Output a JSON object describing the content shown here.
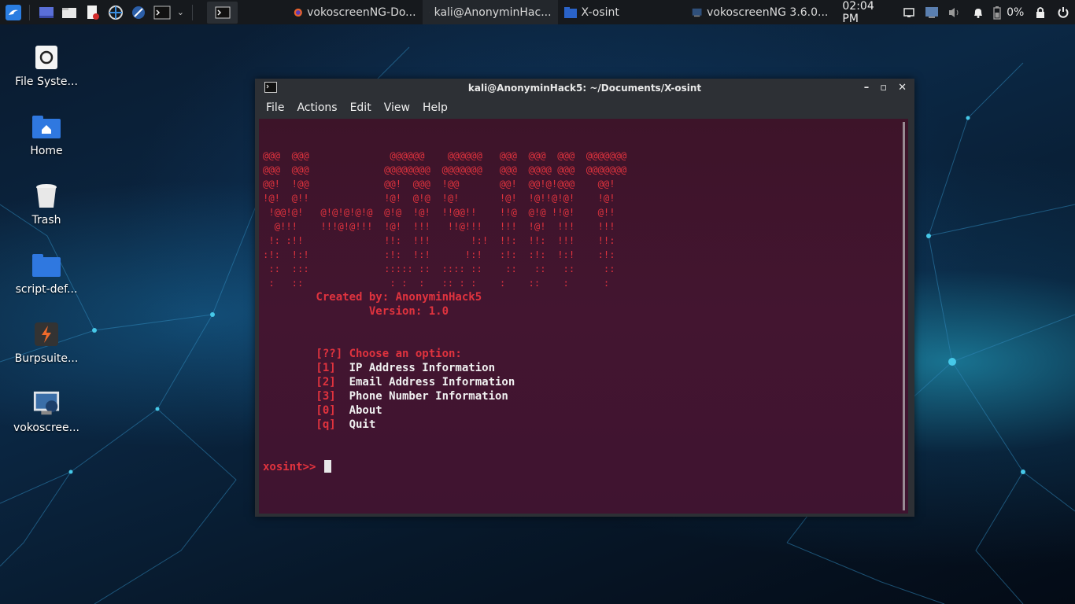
{
  "taskbar": {
    "tasks": [
      {
        "label": "vokoscreenNG-Do...",
        "icon": "firefox-icon"
      },
      {
        "label": "kali@AnonyminHac...",
        "icon": "terminal-icon"
      },
      {
        "label": "X-osint",
        "icon": "folder-icon"
      },
      {
        "label": "vokoscreenNG 3.6.0...",
        "icon": "vokoscreen-icon"
      }
    ],
    "clock": "02:04 PM",
    "battery": "0%"
  },
  "desktop": {
    "icons": [
      {
        "label": "File Syste..."
      },
      {
        "label": "Home"
      },
      {
        "label": "Trash"
      },
      {
        "label": "script-def..."
      },
      {
        "label": "Burpsuite..."
      },
      {
        "label": "vokoscree..."
      }
    ]
  },
  "window": {
    "title": "kali@AnonyminHack5: ~/Documents/X-osint",
    "menu": [
      "File",
      "Actions",
      "Edit",
      "View",
      "Help"
    ]
  },
  "terminal": {
    "banner": [
      "@@@  @@@              @@@@@@    @@@@@@   @@@  @@@  @@@  @@@@@@@",
      "@@@  @@@             @@@@@@@@  @@@@@@@   @@@  @@@@ @@@  @@@@@@@",
      "@@!  !@@             @@!  @@@  !@@       @@!  @@!@!@@@    @@!",
      "!@!  @!!             !@!  @!@  !@!       !@!  !@!!@!@!    !@!",
      " !@@!@!   @!@!@!@!@  @!@  !@!  !!@@!!    !!@  @!@ !!@!    @!!",
      "  @!!!    !!!@!@!!!  !@!  !!!   !!@!!!   !!!  !@!  !!!    !!!",
      " !: :!!              !!:  !!!       !:!  !!:  !!:  !!!    !!:",
      ":!:  !:!             :!:  !:!      !:!   :!:  :!:  !:!    :!:",
      " ::  :::             ::::: ::  :::: ::    ::   ::   ::     ::",
      " :   ::               : :  :   :: : :    :    ::    :      :"
    ],
    "created_by": "        Created by: AnonyminHack5",
    "version": "                Version: 1.0",
    "prompt_line": "        [??] Choose an option:",
    "options": [
      {
        "key": "        [1]",
        "label": "  IP Address Information"
      },
      {
        "key": "        [2]",
        "label": "  Email Address Information"
      },
      {
        "key": "        [3]",
        "label": "  Phone Number Information"
      },
      {
        "key": "        [0]",
        "label": "  About"
      },
      {
        "key": "        [q]",
        "label": "  Quit"
      }
    ],
    "prompt": "xosint>>"
  }
}
